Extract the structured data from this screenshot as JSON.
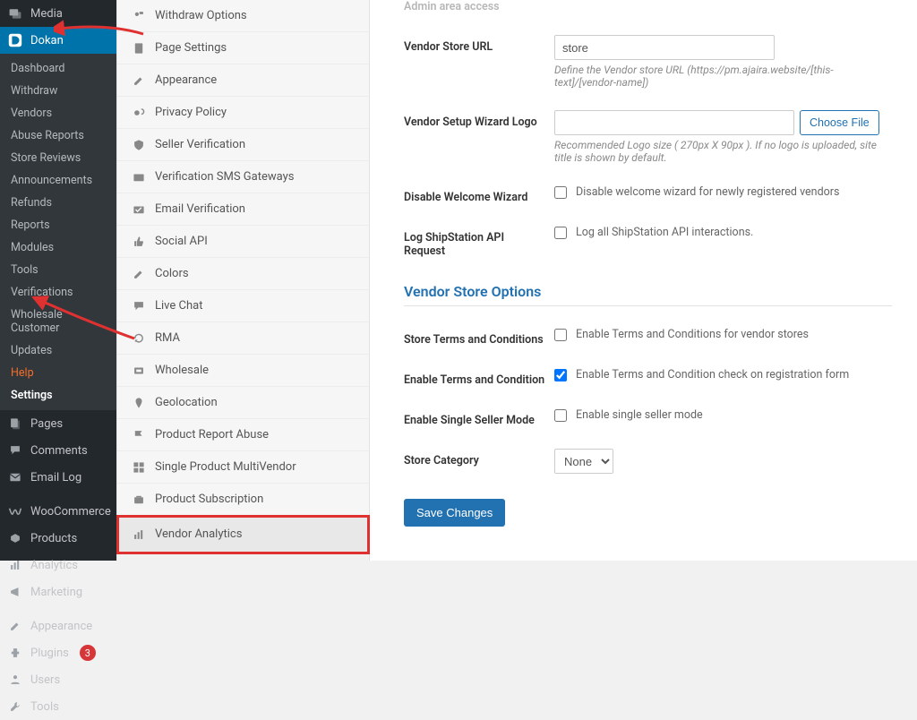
{
  "wp_menu": {
    "media": "Media",
    "dokan": "Dokan",
    "pages": "Pages",
    "comments": "Comments",
    "email_log": "Email Log",
    "woocommerce": "WooCommerce",
    "products": "Products",
    "analytics": "Analytics",
    "marketing": "Marketing",
    "appearance": "Appearance",
    "plugins": "Plugins",
    "plugins_badge": "3",
    "users": "Users",
    "tools": "Tools"
  },
  "dokan_submenu": [
    "Dashboard",
    "Withdraw",
    "Vendors",
    "Abuse Reports",
    "Store Reviews",
    "Announcements",
    "Refunds",
    "Reports",
    "Modules",
    "Tools",
    "Verifications",
    "Wholesale Customer",
    "Updates",
    "Help",
    "Settings"
  ],
  "settings_tabs": [
    {
      "icon": "withdraw",
      "label": "Withdraw Options"
    },
    {
      "icon": "page",
      "label": "Page Settings"
    },
    {
      "icon": "appearance",
      "label": "Appearance"
    },
    {
      "icon": "privacy",
      "label": "Privacy Policy"
    },
    {
      "icon": "shield",
      "label": "Seller Verification"
    },
    {
      "icon": "mail",
      "label": "Verification SMS Gateways"
    },
    {
      "icon": "check-mail",
      "label": "Email Verification"
    },
    {
      "icon": "thumb",
      "label": "Social API"
    },
    {
      "icon": "brush",
      "label": "Colors"
    },
    {
      "icon": "chat",
      "label": "Live Chat"
    },
    {
      "icon": "refresh",
      "label": "RMA"
    },
    {
      "icon": "wholesale",
      "label": "Wholesale"
    },
    {
      "icon": "pin",
      "label": "Geolocation"
    },
    {
      "icon": "flag",
      "label": "Product Report Abuse"
    },
    {
      "icon": "grid",
      "label": "Single Product MultiVendor"
    },
    {
      "icon": "sub",
      "label": "Product Subscription"
    },
    {
      "icon": "analytics",
      "label": "Vendor Analytics"
    }
  ],
  "form": {
    "admin_area_access": "Admin area access",
    "vendor_store_url_label": "Vendor Store URL",
    "vendor_store_url_value": "store",
    "vendor_store_url_hint": "Define the Vendor store URL (https://pm.ajaira.website/[this-text]/[vendor-name])",
    "wizard_logo_label": "Vendor Setup Wizard Logo",
    "wizard_logo_btn": "Choose File",
    "wizard_logo_hint": "Recommended Logo size ( 270px X 90px ). If no logo is uploaded, site title is shown by default.",
    "disable_wizard_label": "Disable Welcome Wizard",
    "disable_wizard_chk": "Disable welcome wizard for newly registered vendors",
    "log_shipstation_label": "Log ShipStation API Request",
    "log_shipstation_chk": "Log all ShipStation API interactions.",
    "section_store": "Vendor Store Options",
    "terms_label": "Store Terms and Conditions",
    "terms_chk": "Enable Terms and Conditions for vendor stores",
    "enable_terms_label": "Enable Terms and Condition",
    "enable_terms_chk": "Enable Terms and Condition check on registration form",
    "single_seller_label": "Enable Single Seller Mode",
    "single_seller_chk": "Enable single seller mode",
    "store_category_label": "Store Category",
    "store_category_value": "None",
    "save": "Save Changes"
  },
  "colors": {
    "accent": "#2271b1",
    "wp_active": "#0073aa",
    "red": "#e03131"
  }
}
